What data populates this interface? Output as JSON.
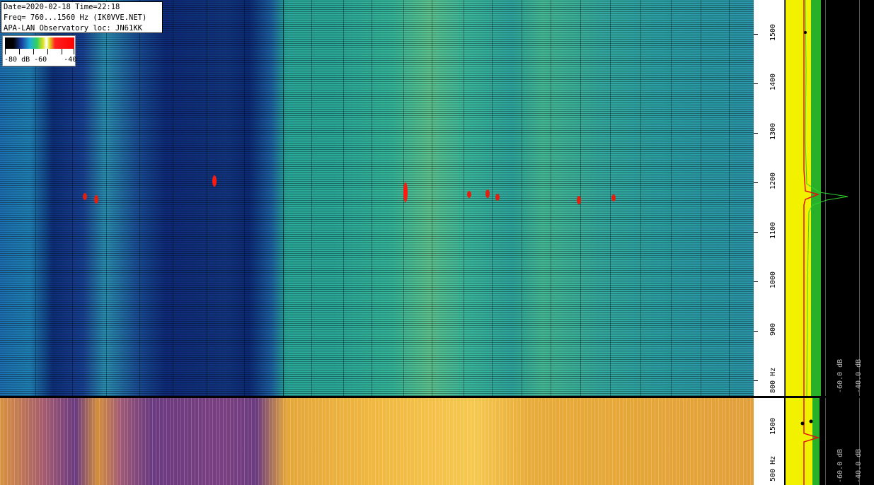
{
  "info": {
    "line1": "Date=2020-02-18 Time=22:18",
    "line2": "Freq= 760...1560 Hz (IK0VVE.NET)",
    "line3": "APA-LAN Observatory loc: JN61KK"
  },
  "color_scale": {
    "labels": "-80 dB -60    -40"
  },
  "freq_axis": {
    "ticks": [
      "1500",
      "1400",
      "1300",
      "1200",
      "1100",
      "1000",
      "900",
      "800 Hz"
    ]
  },
  "freq_axis_bottom": {
    "ticks": [
      "1500",
      "500 Hz"
    ]
  },
  "spectrum": {
    "db_labels": [
      "-60.0 dB",
      "-40.0 dB"
    ]
  },
  "spectrum_bottom": {
    "db_labels": [
      "-60.0 dB",
      "-40.0 dB"
    ]
  },
  "colors": {
    "trace_yellow": "#f2f200",
    "trace_green": "#2fd02f",
    "trace_red": "#e01010",
    "time_label": "#c41a1a"
  }
}
